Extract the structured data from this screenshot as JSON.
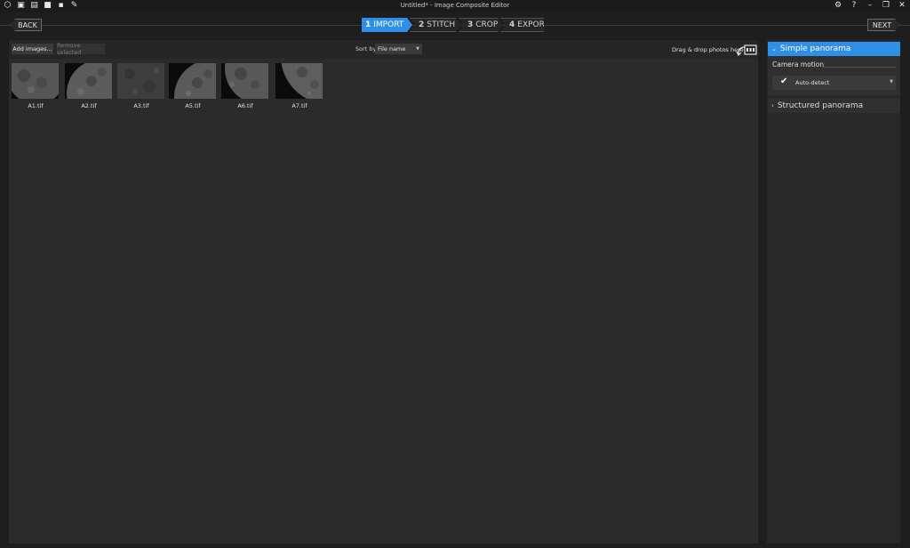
{
  "window": {
    "title": "Untitled* - Image Composite Editor",
    "toolbar_icons": [
      "new-project-icon",
      "new-panorama-icon",
      "new-video-panorama-icon",
      "open-folder-icon",
      "save-icon",
      "publish-icon"
    ],
    "controls": [
      "settings-icon",
      "help-icon",
      "minimize-icon",
      "restore-icon",
      "close-icon"
    ]
  },
  "wizard": {
    "back_label": "BACK",
    "next_label": "NEXT",
    "steps": [
      {
        "num": "1",
        "label": "IMPORT",
        "active": true
      },
      {
        "num": "2",
        "label": "STITCH",
        "active": false
      },
      {
        "num": "3",
        "label": "CROP",
        "active": false
      },
      {
        "num": "4",
        "label": "EXPORT",
        "active": false
      }
    ]
  },
  "import_toolbar": {
    "add_label": "Add images...",
    "remove_label": "Remove selected",
    "sort_label": "Sort by",
    "sort_value": "File name",
    "drop_hint": "Drag & drop photos here"
  },
  "images": [
    {
      "name": "A1.tif"
    },
    {
      "name": "A2.tif"
    },
    {
      "name": "A3.tif"
    },
    {
      "name": "A5.tif"
    },
    {
      "name": "A6.tif"
    },
    {
      "name": "A7.tif"
    }
  ],
  "side_panel": {
    "simple_label": "Simple panorama",
    "camera_motion_label": "Camera motion",
    "camera_motion_value": "Auto-detect",
    "structured_label": "Structured panorama"
  },
  "colors": {
    "accent": "#2f8fe6",
    "background": "#1e1e1e",
    "panel": "#2b2b2b"
  }
}
